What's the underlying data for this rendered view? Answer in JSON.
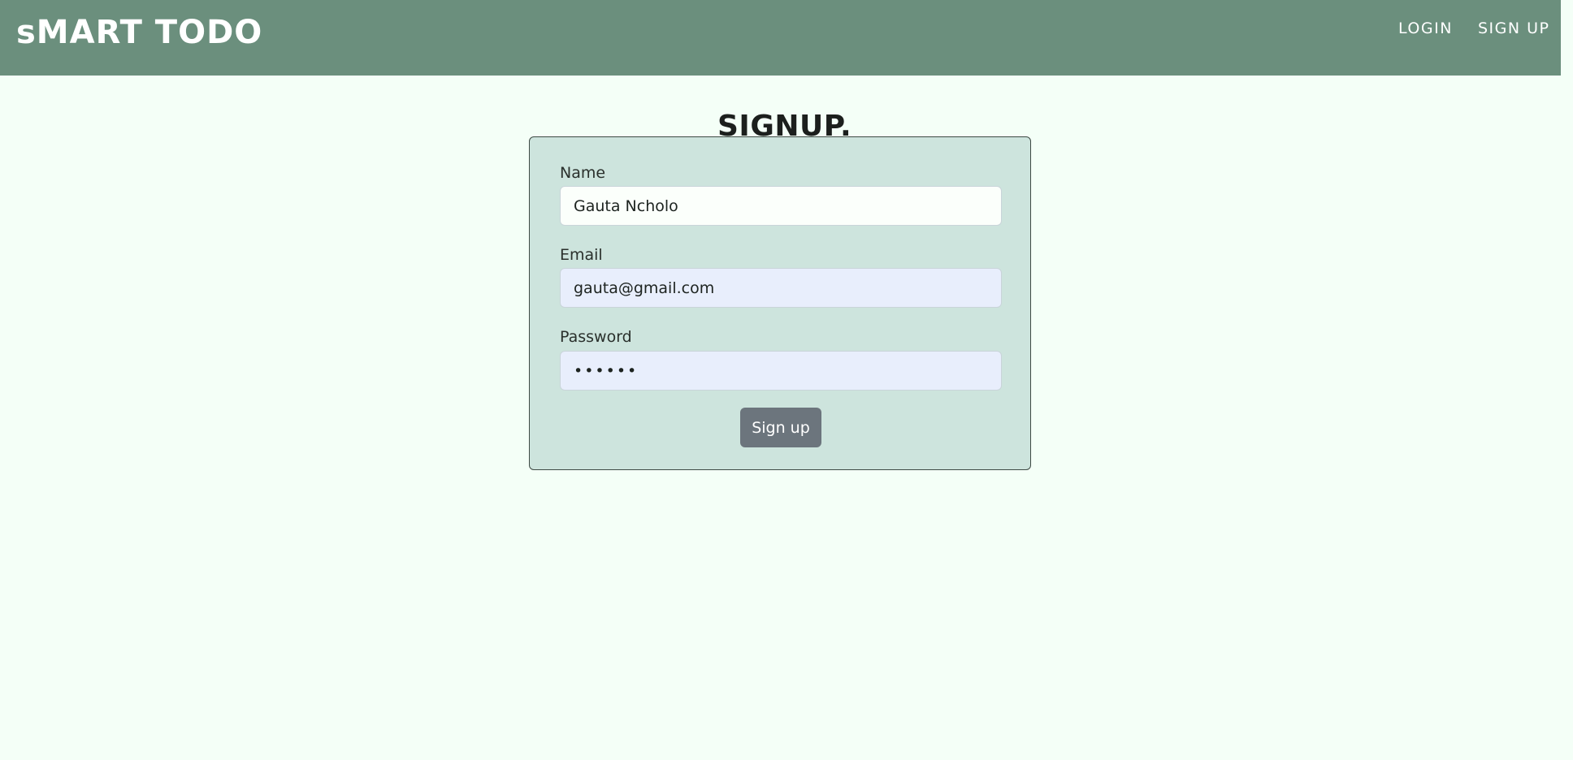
{
  "header": {
    "brand": "sMART TODO",
    "nav": {
      "login_label": "LOGIN",
      "signup_label": "SIGN UP"
    },
    "background_color": "#6b8f7d"
  },
  "main": {
    "title": "SIGNUP.",
    "form": {
      "name": {
        "label": "Name",
        "value": "Gauta Ncholo"
      },
      "email": {
        "label": "Email",
        "value": "gauta@gmail.com"
      },
      "password": {
        "label": "Password",
        "value": "••••••"
      },
      "submit_label": "Sign up"
    }
  },
  "colors": {
    "page_background": "#f4fff7",
    "card_background": "#cde4dd",
    "button_background": "#6c757d",
    "autofill_background": "#e8eefc"
  }
}
